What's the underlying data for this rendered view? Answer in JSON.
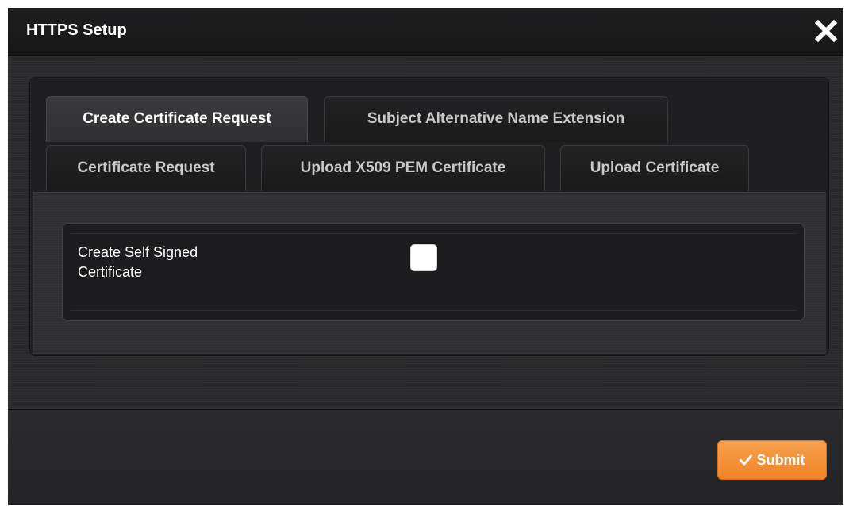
{
  "dialog": {
    "title": "HTTPS Setup",
    "close_icon": "close-icon"
  },
  "tabs": [
    {
      "label": "Create Certificate Request",
      "active": true
    },
    {
      "label": "Subject Alternative Name Extension",
      "active": false
    },
    {
      "label": "Certificate Request",
      "active": false
    },
    {
      "label": "Upload X509 PEM Certificate",
      "active": false
    },
    {
      "label": "Upload Certificate",
      "active": false
    }
  ],
  "form": {
    "self_signed_label": "Create Self Signed Certificate",
    "self_signed_checked": false
  },
  "footer": {
    "submit_label": "Submit",
    "submit_icon": "checkmark-icon"
  },
  "colors": {
    "accent": "#f08426",
    "background": "#2a2a2c"
  }
}
